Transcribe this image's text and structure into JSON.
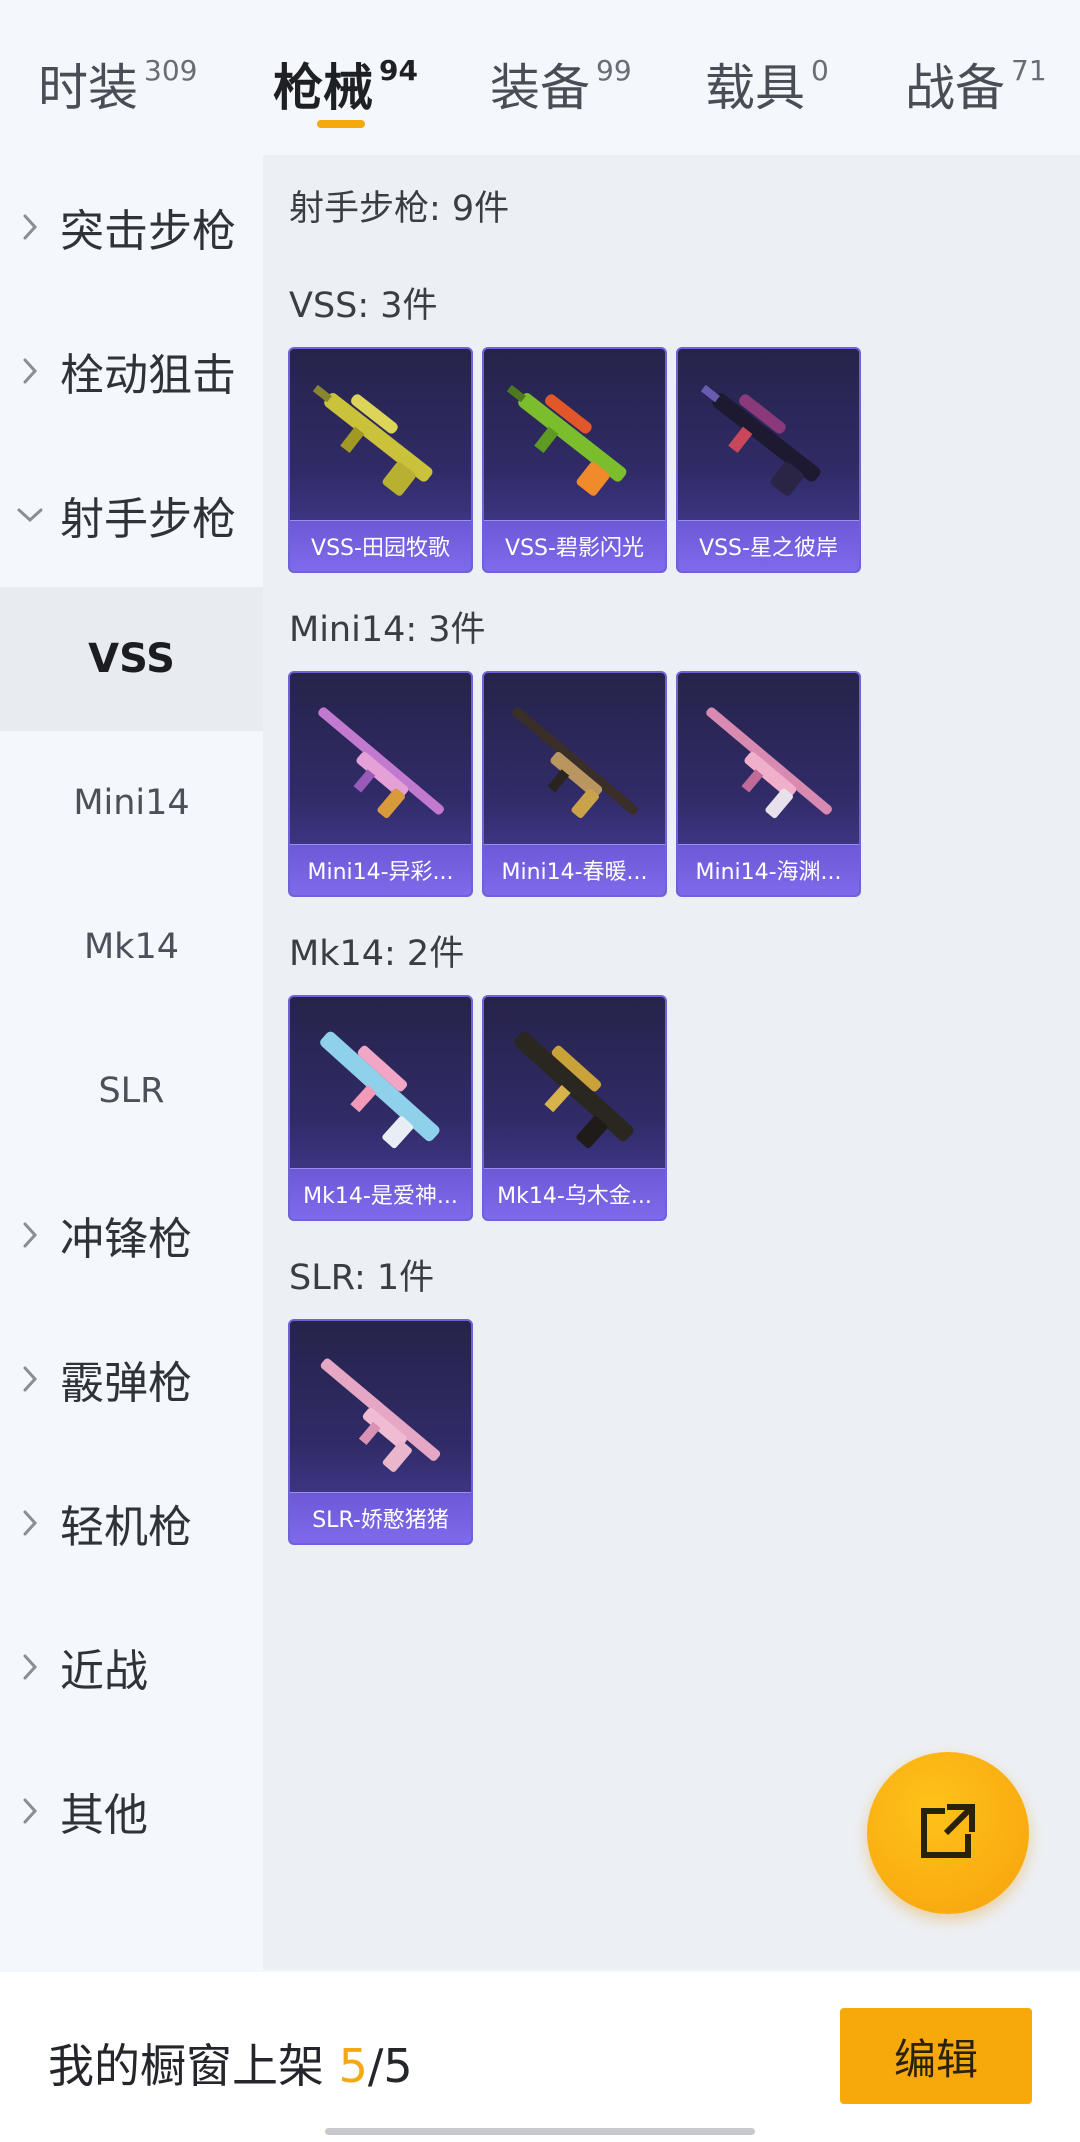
{
  "tabs": [
    {
      "label": "时装",
      "count": "309"
    },
    {
      "label": "枪械",
      "count": "94"
    },
    {
      "label": "装备",
      "count": "99"
    },
    {
      "label": "载具",
      "count": "0"
    },
    {
      "label": "战备",
      "count": "71"
    }
  ],
  "active_tab": "枪械",
  "sidebar": {
    "categories": [
      "突击步枪",
      "栓动狙击",
      "射手步枪",
      "冲锋枪",
      "霰弹枪",
      "轻机枪",
      "近战",
      "其他"
    ],
    "expanded": "射手步枪",
    "subitems": [
      "VSS",
      "Mini14",
      "Mk14",
      "SLR"
    ],
    "selected_sub": "VSS"
  },
  "content": {
    "header": "射手步枪: 9件",
    "sections": [
      {
        "title": "VSS: 3件",
        "items": [
          "VSS-田园牧歌",
          "VSS-碧影闪光",
          "VSS-星之彼岸"
        ]
      },
      {
        "title": "Mini14: 3件",
        "items": [
          "Mini14-异彩...",
          "Mini14-春暖...",
          "Mini14-海渊..."
        ]
      },
      {
        "title": "Mk14: 2件",
        "items": [
          "Mk14-是爱神...",
          "Mk14-乌木金..."
        ]
      },
      {
        "title": "SLR: 1件",
        "items": [
          "SLR-娇憨猪猪"
        ]
      }
    ]
  },
  "bottom": {
    "shelf_label": "我的橱窗上架 ",
    "shelf_current": "5",
    "shelf_sep": "/",
    "shelf_total": "5",
    "edit_label": "编辑"
  },
  "icons": {
    "share": "share-external-icon",
    "chevron_right": "chevron-right-icon",
    "chevron_down": "chevron-down-icon"
  },
  "colors": {
    "accent": "#f6a90d",
    "card_border": "#6f62d6",
    "card_caption": "#7560e0"
  }
}
